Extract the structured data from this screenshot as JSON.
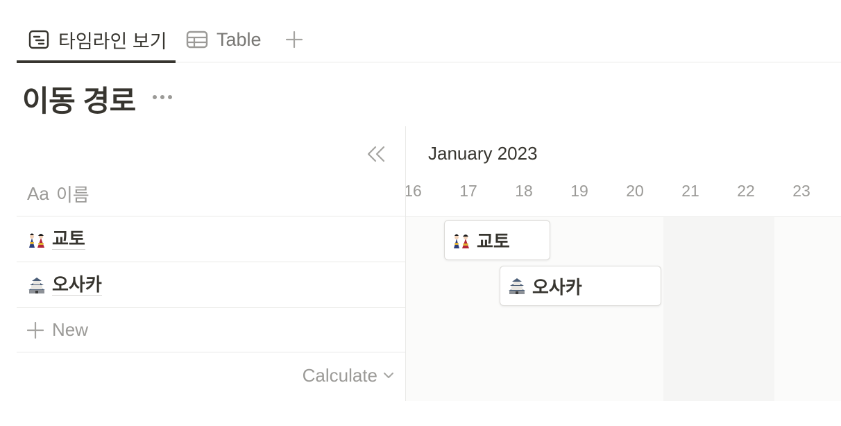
{
  "tabs": [
    {
      "label": "타임라인 보기",
      "icon": "timeline-icon",
      "active": true
    },
    {
      "label": "Table",
      "icon": "table-icon",
      "active": false
    }
  ],
  "add_view_icon": "plus-icon",
  "page": {
    "title": "이동 경로",
    "more_icon": "more-dots-icon"
  },
  "table": {
    "collapse_icon": "double-chevron-left-icon",
    "column_header": {
      "prefix": "Aa",
      "label": "이름"
    },
    "rows": [
      {
        "name": "교토",
        "emoji": "kyoto-dolls-emoji"
      },
      {
        "name": "오사카",
        "emoji": "japanese-castle-emoji"
      }
    ],
    "new_label": "New",
    "calculate_label": "Calculate"
  },
  "timeline": {
    "month": "January 2023",
    "days": [
      "16",
      "17",
      "18",
      "19",
      "20",
      "21",
      "22",
      "23"
    ],
    "weekend_days": [
      "21",
      "22"
    ],
    "items": [
      {
        "name": "교토",
        "start": "17",
        "end": "18"
      },
      {
        "name": "오사카",
        "start": "18",
        "end": "20"
      }
    ]
  },
  "colors": {
    "text": "#37352f",
    "muted": "#9b9a97",
    "border": "#e9e9e7",
    "weekend": "#f5f5f4"
  }
}
